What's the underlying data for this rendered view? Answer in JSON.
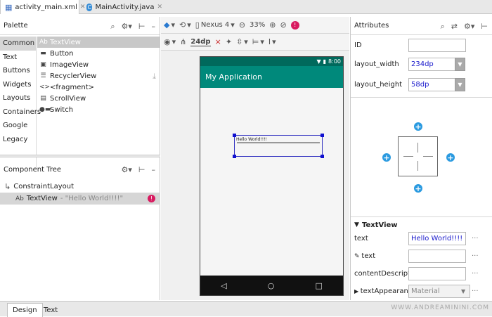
{
  "tabs": [
    {
      "label": "activity_main.xml",
      "icon": "xml-file-icon"
    },
    {
      "label": "MainActivity.java",
      "icon": "java-class-icon"
    }
  ],
  "palette": {
    "title": "Palette",
    "categories": [
      "Common",
      "Text",
      "Buttons",
      "Widgets",
      "Layouts",
      "Containers",
      "Google",
      "Legacy"
    ],
    "widgets": [
      {
        "icon": "Ab",
        "label": "TextView"
      },
      {
        "icon": "▬",
        "label": "Button"
      },
      {
        "icon": "▣",
        "label": "ImageView"
      },
      {
        "icon": "☰",
        "label": "RecyclerView"
      },
      {
        "icon": "<>",
        "label": "<fragment>"
      },
      {
        "icon": "▤",
        "label": "ScrollView"
      },
      {
        "icon": "●▬",
        "label": "Switch"
      }
    ]
  },
  "component_tree": {
    "title": "Component Tree",
    "root": "ConstraintLayout",
    "child_icon": "Ab",
    "child_name": "TextView",
    "child_text": "- \"Hello World!!!!\""
  },
  "toolbar": {
    "device": "Nexus 4",
    "zoom": "33%",
    "margin": "24dp"
  },
  "preview": {
    "status_time": "8:00",
    "app_title": "My Application",
    "textview_text": "Hello World!!!!"
  },
  "attributes": {
    "title": "Attributes",
    "id_label": "ID",
    "id_value": "",
    "width_label": "layout_width",
    "width_value": "234dp",
    "height_label": "layout_height",
    "height_value": "58dp",
    "section": "TextView",
    "text_label": "text",
    "text_value": "Hello World!!!!",
    "tools_text_label": "text",
    "tools_text_value": "",
    "content_desc_label": "contentDescriptio",
    "content_desc_value": "",
    "appearance_label": "textAppearanc",
    "appearance_value": "Material"
  },
  "bottom_tabs": [
    "Design",
    "Text"
  ],
  "watermark": "WWW.ANDREAMININI.COM",
  "colors": {
    "accent": "#2a9ae0",
    "app_bar": "#00897b",
    "status_bar": "#00695c",
    "error": "#d81b60",
    "selection": "#1010d0"
  }
}
